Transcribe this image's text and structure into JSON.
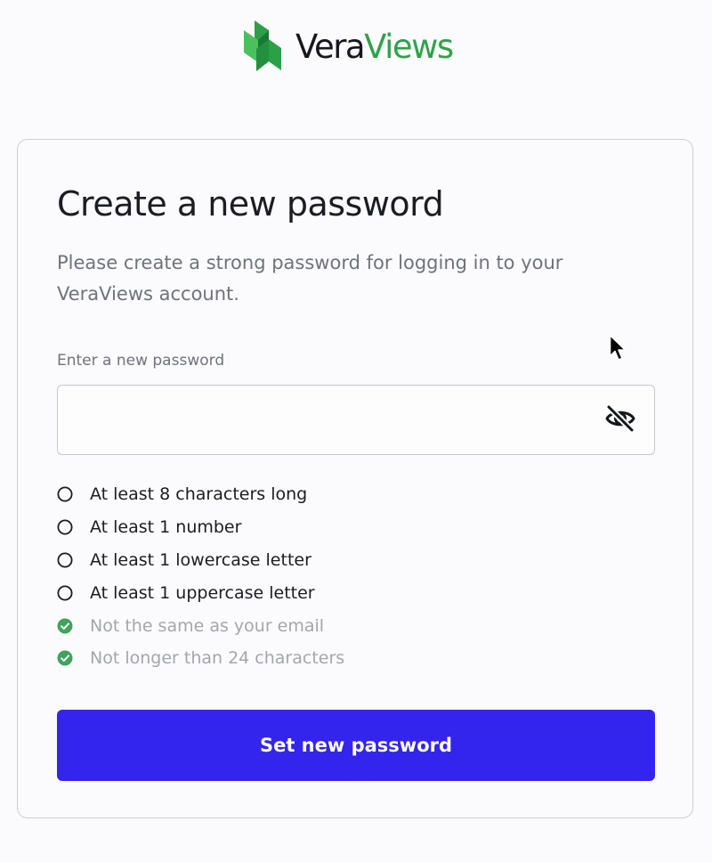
{
  "brand": {
    "name_part1": "Vera",
    "name_part2": "Views",
    "logo_icon": "veraviews-logo-icon",
    "color_dark": "#16181d",
    "color_green": "#2fa24a"
  },
  "card": {
    "title": "Create a new password",
    "subtitle": "Please create a strong password for logging in to your VeraViews account."
  },
  "password_field": {
    "label": "Enter a new password",
    "value": "",
    "placeholder": "",
    "toggle_icon": "eye-slash-icon"
  },
  "requirements": [
    {
      "text": "At least 8 characters long",
      "met": false
    },
    {
      "text": "At least 1 number",
      "met": false
    },
    {
      "text": "At least 1 lowercase letter",
      "met": false
    },
    {
      "text": "At least 1 uppercase letter",
      "met": false
    },
    {
      "text": "Not the same as your email",
      "met": true
    },
    {
      "text": "Not longer than 24 characters",
      "met": true
    }
  ],
  "submit": {
    "label": "Set new password",
    "color": "#3324ee"
  },
  "colors": {
    "check_green": "#3fa45a",
    "met_text": "#a3a6ab"
  }
}
